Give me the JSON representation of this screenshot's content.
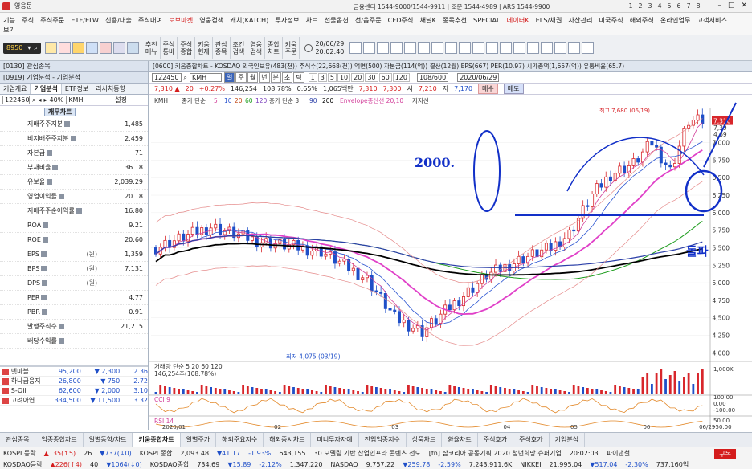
{
  "window": {
    "title": "영웅문",
    "phone_info": "금융센터 1544-9000/1544-9911 | 조문 1544-4989 | ARS 1544-9900",
    "screen_tabs": [
      "1",
      "2",
      "3",
      "4",
      "5",
      "6",
      "7",
      "8"
    ]
  },
  "menu": {
    "items": [
      "기능",
      "주식",
      "주식주문",
      "ETF/ELW",
      "신용/대출",
      "주식대여",
      "로보마켓",
      "영웅검색",
      "캐치(KATCH)",
      "투자정보",
      "차트",
      "선물옵션",
      "선/옵주문",
      "CFD주식",
      "채널K",
      "종목추천",
      "SPECIAL",
      "데이터K",
      "ELS/채권",
      "자산관리",
      "미국주식",
      "해외주식",
      "온라인업무",
      "고객서비스",
      "보기"
    ],
    "highlight": [
      "로보마켓",
      "데이터K"
    ]
  },
  "toolbar": {
    "code": "8950",
    "buttons": [
      {
        "l1": "추천",
        "l2": "메뉴"
      },
      {
        "l1": "주식",
        "l2": "통바"
      },
      {
        "l1": "주식",
        "l2": "종합"
      },
      {
        "l1": "키움",
        "l2": "현재"
      },
      {
        "l1": "관심",
        "l2": "종목"
      },
      {
        "l1": "조건",
        "l2": "검색"
      },
      {
        "l1": "영웅",
        "l2": "검색"
      },
      {
        "l1": "종합",
        "l2": "차트"
      },
      {
        "l1": "키움",
        "l2": "주문"
      }
    ],
    "date": "20/06/29",
    "time": "20:02:40"
  },
  "left": {
    "panel1_title": "[0130] 관심종목",
    "panel2_title": "[0919] 기업분석 - 기업분석",
    "tabs": [
      "기업개요",
      "기업분석",
      "ETF정보",
      "리서치동향"
    ],
    "active_tab": "기업분석",
    "code": "122450",
    "pct": "40%",
    "name": "KMH",
    "setting": "설정",
    "fin_button": "재무차트",
    "rows": [
      {
        "label": "지배주주지분",
        "unit": "",
        "value": "1,485"
      },
      {
        "label": "비지배주주지분",
        "unit": "",
        "value": "2,459"
      },
      {
        "label": "자본금",
        "unit": "",
        "value": "71"
      },
      {
        "label": "부채비율",
        "unit": "",
        "value": "36.18"
      },
      {
        "label": "유보율",
        "unit": "",
        "value": "2,039.29"
      },
      {
        "label": "영업이익률",
        "unit": "",
        "value": "20.18"
      },
      {
        "label": "지배주주순이익률",
        "unit": "",
        "value": "16.80"
      },
      {
        "label": "ROA",
        "unit": "",
        "value": "9.21"
      },
      {
        "label": "ROE",
        "unit": "",
        "value": "20.60"
      },
      {
        "label": "EPS",
        "unit": "(원)",
        "value": "1,359"
      },
      {
        "label": "BPS",
        "unit": "(원)",
        "value": "7,131"
      },
      {
        "label": "DPS",
        "unit": "(원)",
        "value": ""
      },
      {
        "label": "PER",
        "unit": "",
        "value": "4.77"
      },
      {
        "label": "PBR",
        "unit": "",
        "value": "0.91"
      },
      {
        "label": "발행주식수",
        "unit": "",
        "value": "21,215"
      },
      {
        "label": "배당수익률",
        "unit": "",
        "value": ""
      }
    ],
    "stocks": [
      {
        "name": "넷마블",
        "price": "95,200",
        "chg": "▼ 2,300",
        "pct": "2.36"
      },
      {
        "name": "하나금융지",
        "price": "26,800",
        "chg": "▼ 750",
        "pct": "2.72"
      },
      {
        "name": "S-Oil",
        "price": "62,600",
        "chg": "▼ 2,000",
        "pct": "3.10"
      },
      {
        "name": "고려아연",
        "price": "334,500",
        "chg": "▼ 11,500",
        "pct": "3.32"
      }
    ]
  },
  "chart": {
    "window_title": "[0600] 키움종합차트 - KOSDAQ 외국인보유(483(천)) 주식수(22,668(천)) 액면(500) 자본금(114(억)) 결산(12월) EPS(667) PER(10.97) 시가총액(1,657(억)) 유통비율(65.7)",
    "code": "122450",
    "name": "KMH",
    "period_buttons": [
      "일",
      "주",
      "월",
      "년",
      "분",
      "초",
      "틱"
    ],
    "num_buttons": [
      "1",
      "3",
      "5",
      "10",
      "20",
      "30",
      "60",
      "120"
    ],
    "count": "108/600",
    "date": "2020/06/29",
    "price": "7,310",
    "change": "20",
    "change_pct": "+0.27%",
    "volume": "146,254",
    "vol_pct": "108.78%",
    "turnover": "0.65%",
    "amount": "1,065백만",
    "open": "7,310",
    "high": "7,300",
    "high_label": "고",
    "open_label": "시",
    "open_val": "7,210",
    "low_label": "저",
    "low_val": "7,170",
    "buy": "매수",
    "sell": "매도",
    "legend_main": "KMH",
    "legend_ma_label": "종가 단순",
    "legend_ma": [
      "5",
      "10",
      "20",
      "60",
      "120"
    ],
    "legend_ma2": "종가 단순 3",
    "legend_ma2_vals": [
      "90",
      "200"
    ],
    "legend_env": "Envelope종산선 20,10",
    "legend_support": "지지선",
    "vol_legend": "거래량 단순 5 20 60 120",
    "vol_value": "146,254주(108.78%)",
    "cci_legend": "CCI 9",
    "rsi_legend": "RSI 14",
    "low_annot": "최저 4,075 (03/19)",
    "high_annot": "최고 7,680 (06/19)",
    "hw_text_1": "2000.",
    "hw_text_2": "돌파",
    "x_ticks": [
      "2020/01",
      "02",
      "03",
      "04",
      "05",
      "06",
      "06/29"
    ],
    "y_ticks": [
      "7,000",
      "6,750",
      "6,500",
      "6,250",
      "6,000",
      "5,750",
      "5,500",
      "5,250",
      "5,000",
      "4,750",
      "4,500",
      "4,250",
      "4,000"
    ],
    "y_top_labels": [
      "7,39",
      "4,69"
    ],
    "price_tag": "7,310",
    "vol_ticks": [
      "1,000K",
      "146,254"
    ],
    "cci_ticks": [
      "100.00",
      "0.00",
      "-100.00"
    ],
    "rsi_ticks": [
      "50.00",
      "-50.00"
    ]
  },
  "bottom_tabs": [
    "관심종목",
    "업종종합차트",
    "일별동향/차트",
    "키움종합차트",
    "일별주가",
    "해외주요지수",
    "해외증시차트",
    "미니투자자예",
    "전업업종지수",
    "상품차트",
    "환율차트",
    "주식호가",
    "주식호가",
    "기업분석"
  ],
  "active_bottom_tab": "키움종합차트",
  "ticker": {
    "row1": [
      "KOSPI 등락",
      "▲135(↑5)",
      "26",
      "▼737(↓0)",
      "KOSPI 종합",
      "2,093.48",
      "▼41.17",
      "-1.93%",
      "643,155",
      "30 모델링 기반 산업인프라 콘텐츠 선도",
      "[fn] 잡코리아 공동기획 2020 청년희망 슈퍼기업",
      "20:02:03",
      "파이낸셜"
    ],
    "row2": [
      "KOSDAQ등락",
      "▲226(↑4)",
      "40",
      "▼1064(↓0)",
      "KOSDAQ종합",
      "734.69",
      "▼15.89",
      "-2.12%",
      "1,347,220",
      "NASDAQ",
      "9,757.22",
      "▼259.78",
      "-2.59%",
      "7,243,911.6K",
      "NIKKEI",
      "21,995.04",
      "▼517.04",
      "-2.30%",
      "737,160억"
    ],
    "order_button": "구독"
  }
}
